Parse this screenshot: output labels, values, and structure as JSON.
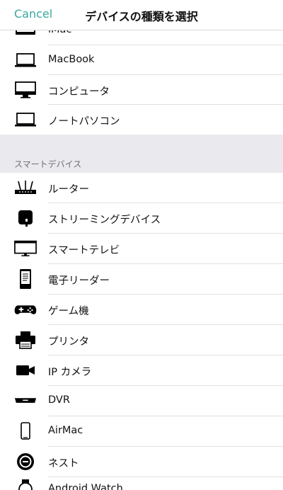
{
  "nav": {
    "cancel_label": "Cancel",
    "title": "デバイスの種類を選択"
  },
  "computers": [
    {
      "label": "iMac",
      "icon": "imac-icon"
    },
    {
      "label": "MacBook",
      "icon": "laptop-icon"
    },
    {
      "label": "コンピュータ",
      "icon": "monitor-icon"
    },
    {
      "label": "ノートパソコン",
      "icon": "laptop-icon"
    }
  ],
  "smart_section": {
    "title": "スマートデバイス",
    "items": [
      {
        "label": "ルーター",
        "icon": "router-icon"
      },
      {
        "label": "ストリーミングデバイス",
        "icon": "streaming-device-icon"
      },
      {
        "label": "スマートテレビ",
        "icon": "tv-icon"
      },
      {
        "label": "電子リーダー",
        "icon": "ereader-icon"
      },
      {
        "label": "ゲーム機",
        "icon": "gamepad-icon"
      },
      {
        "label": "プリンタ",
        "icon": "printer-icon"
      },
      {
        "label": "IP カメラ",
        "icon": "camera-icon"
      },
      {
        "label": "DVR",
        "icon": "dvr-icon"
      },
      {
        "label": "AirMac",
        "icon": "airmac-icon"
      },
      {
        "label": "ネスト",
        "icon": "nest-icon"
      },
      {
        "label": "Android Watch",
        "icon": "watch-icon"
      }
    ]
  }
}
